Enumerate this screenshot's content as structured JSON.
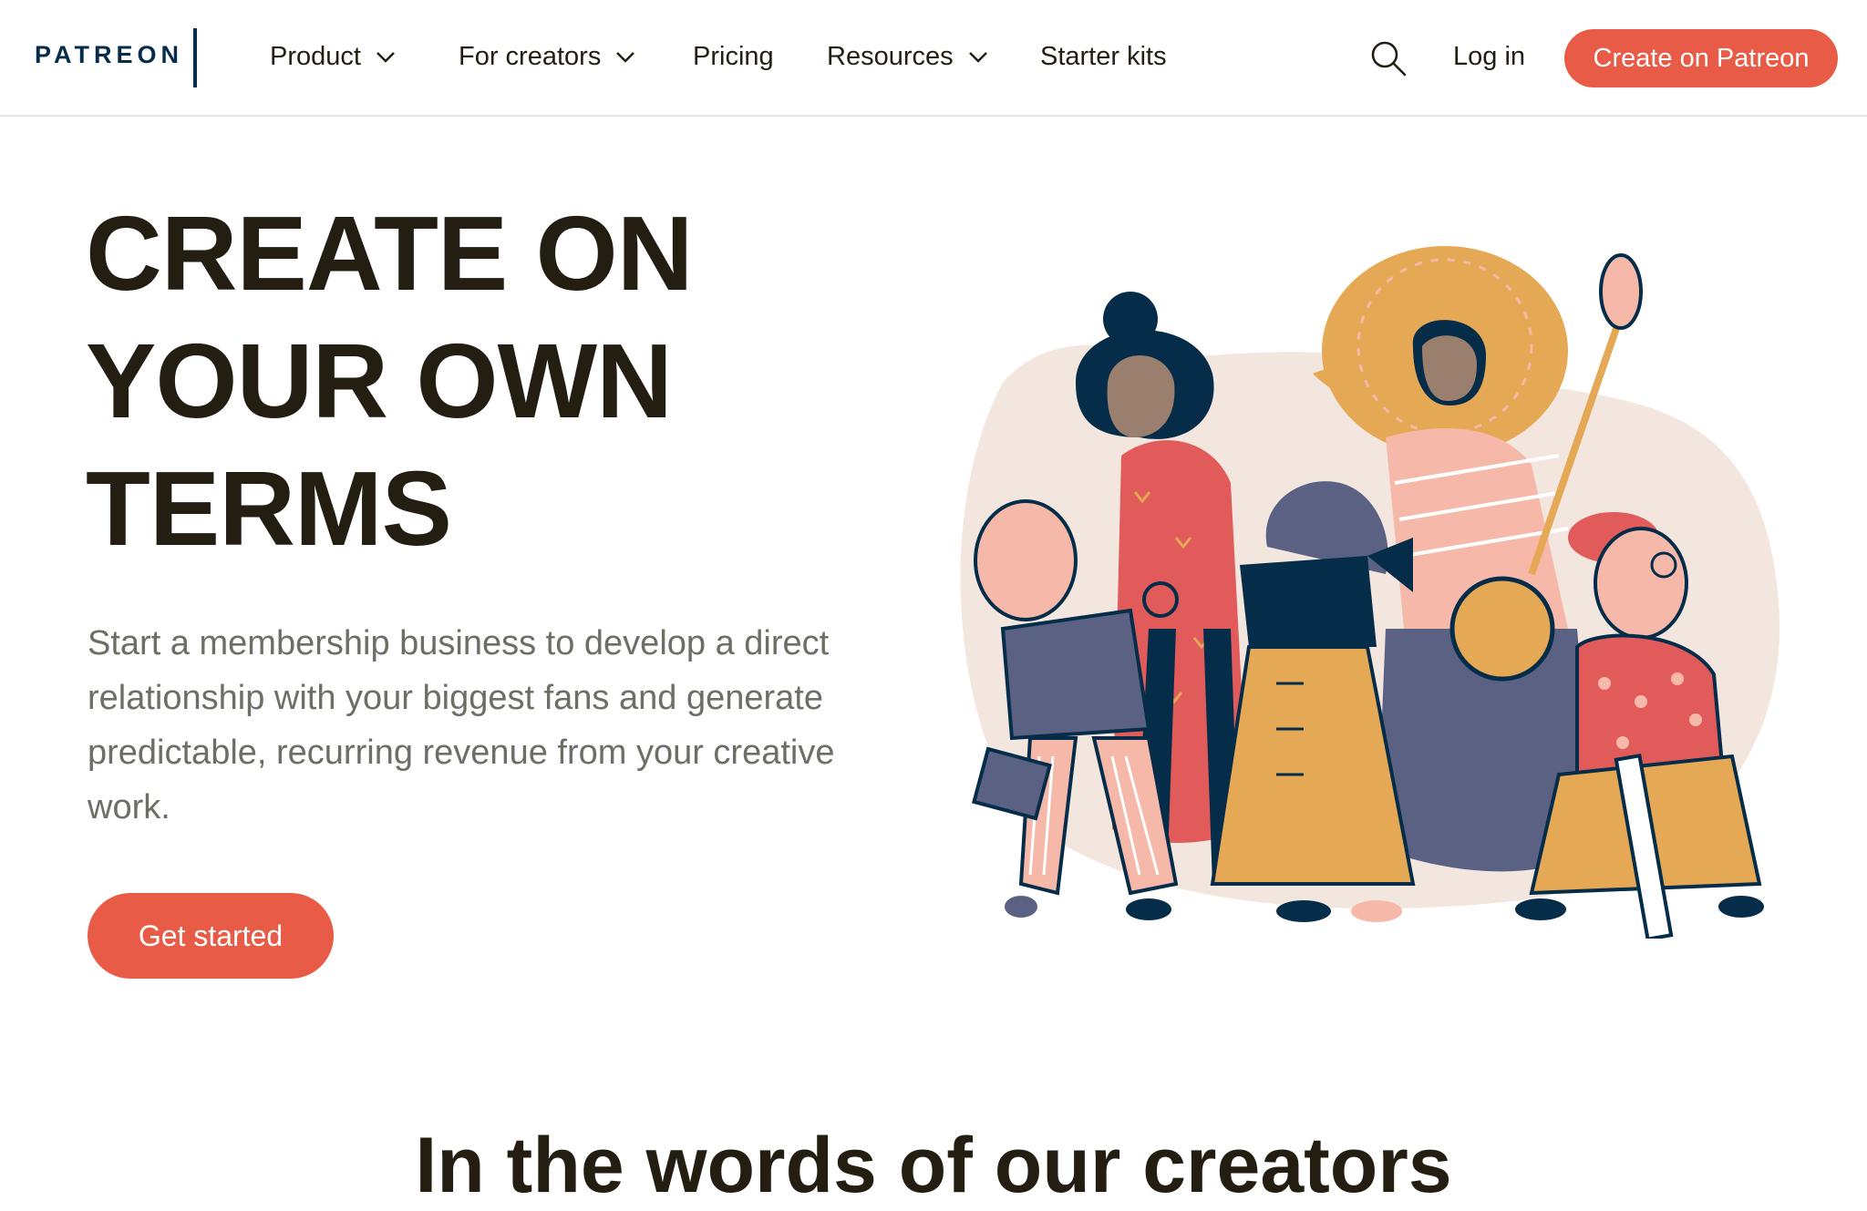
{
  "brand": {
    "logo_text": "PATREON",
    "accent": "#e85b46",
    "navy": "#052d49"
  },
  "nav": {
    "items": [
      {
        "label": "Product",
        "has_dropdown": true
      },
      {
        "label": "For creators",
        "has_dropdown": true
      },
      {
        "label": "Pricing",
        "has_dropdown": false
      },
      {
        "label": "Resources",
        "has_dropdown": true
      },
      {
        "label": "Starter kits",
        "has_dropdown": false
      }
    ],
    "search_icon": "search-icon",
    "login_label": "Log in",
    "cta_label": "Create on Patreon"
  },
  "hero": {
    "title_lines": [
      "CREATE ON",
      "YOUR OWN",
      "TERMS"
    ],
    "subtitle": "Start a membership business to develop a direct relationship with your biggest fans and generate predictable, recurring revenue from your creative work.",
    "button_label": "Get started",
    "illustration": "group-of-creators-illustration"
  },
  "next_section": {
    "title": "In the words of our creators"
  }
}
